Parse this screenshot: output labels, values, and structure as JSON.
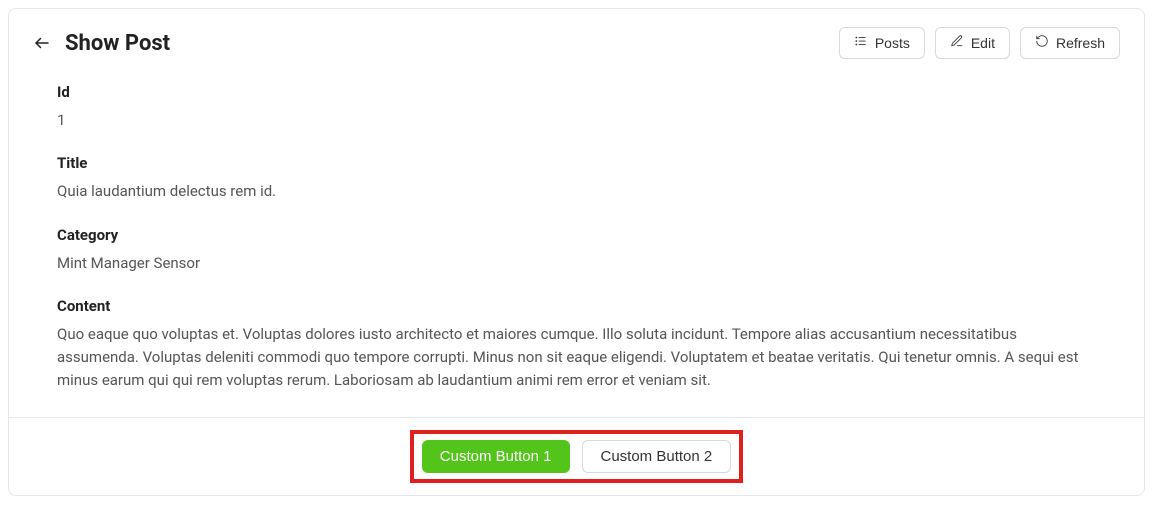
{
  "header": {
    "title": "Show Post",
    "buttons": {
      "posts": "Posts",
      "edit": "Edit",
      "refresh": "Refresh"
    }
  },
  "fields": {
    "id": {
      "label": "Id",
      "value": "1"
    },
    "title": {
      "label": "Title",
      "value": "Quia laudantium delectus rem id."
    },
    "category": {
      "label": "Category",
      "value": "Mint Manager Sensor"
    },
    "content": {
      "label": "Content",
      "value": "Quo eaque quo voluptas et. Voluptas dolores iusto architecto et maiores cumque. Illo soluta incidunt. Tempore alias accusantium necessitatibus assumenda. Voluptas deleniti commodi quo tempore corrupti. Minus non sit eaque eligendi. Voluptatem et beatae veritatis. Qui tenetur omnis. A sequi est minus earum qui qui rem voluptas rerum. Laboriosam ab laudantium animi rem error et veniam sit."
    }
  },
  "footer": {
    "btn1": "Custom Button 1",
    "btn2": "Custom Button 2"
  }
}
